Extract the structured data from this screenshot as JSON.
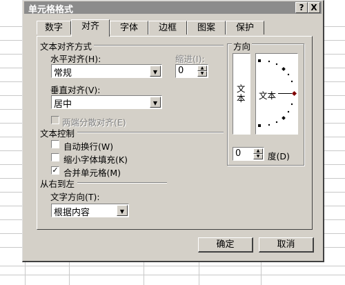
{
  "dialog": {
    "title": "单元格格式",
    "help_label": "?",
    "close_label": "X"
  },
  "tabs": [
    {
      "label": "数字"
    },
    {
      "label": "对齐"
    },
    {
      "label": "字体"
    },
    {
      "label": "边框"
    },
    {
      "label": "图案"
    },
    {
      "label": "保护"
    }
  ],
  "text_alignment": {
    "section_label": "文本对齐方式",
    "horizontal_label": "水平对齐(H):",
    "horizontal_value": "常规",
    "indent_label": "缩进(I):",
    "indent_value": "0",
    "vertical_label": "垂直对齐(V):",
    "vertical_value": "居中",
    "distributed_label": "两端分散对齐(E)"
  },
  "text_control": {
    "section_label": "文本控制",
    "wrap_label": "自动换行(W)",
    "wrap_checked": false,
    "shrink_label": "缩小字体填充(K)",
    "shrink_checked": false,
    "merge_label": "合并单元格(M)",
    "merge_checked": true
  },
  "rtl": {
    "section_label": "从右到左",
    "direction_label": "文字方向(T):",
    "direction_value": "根据内容"
  },
  "orientation": {
    "section_label": "方向",
    "vertical_text": "文本",
    "horizontal_text": "文本",
    "degree_value": "0",
    "degree_label": "度(D)"
  },
  "buttons": {
    "ok": "确定",
    "cancel": "取消"
  },
  "icons": {
    "combo_arrow": "▼",
    "spin_up": "▲",
    "spin_down": "▼",
    "check": "✓"
  }
}
